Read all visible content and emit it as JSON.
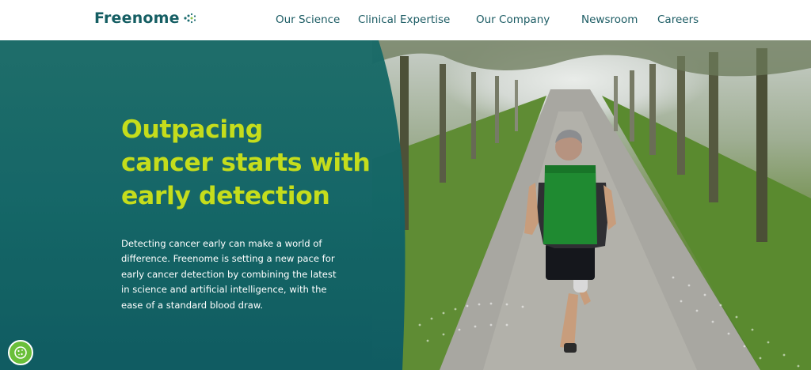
{
  "header": {
    "logo_text": "Freenome",
    "nav": [
      {
        "label": "Our Science"
      },
      {
        "label": "Clinical Expertise"
      },
      {
        "label": "Our Company"
      },
      {
        "label": "Newsroom"
      },
      {
        "label": "Careers"
      }
    ]
  },
  "hero": {
    "title_lines": [
      "Outpacing",
      "cancer starts with",
      "early detection"
    ],
    "body_lines": [
      "Detecting cancer early can make a world of",
      "difference. Freenome is setting a new pace for",
      "early cancer detection by combining the latest",
      "in science and artificial intelligence, with the",
      "ease of a standard blood draw."
    ]
  },
  "colors": {
    "brand_teal": "#155e63",
    "panel_teal": "#146a6e",
    "headline_lime": "#c5dd1c",
    "cookie_green": "#6abf3a"
  },
  "icons": {
    "logo_mark": "dots-icon",
    "cookie": "cookie-icon"
  }
}
